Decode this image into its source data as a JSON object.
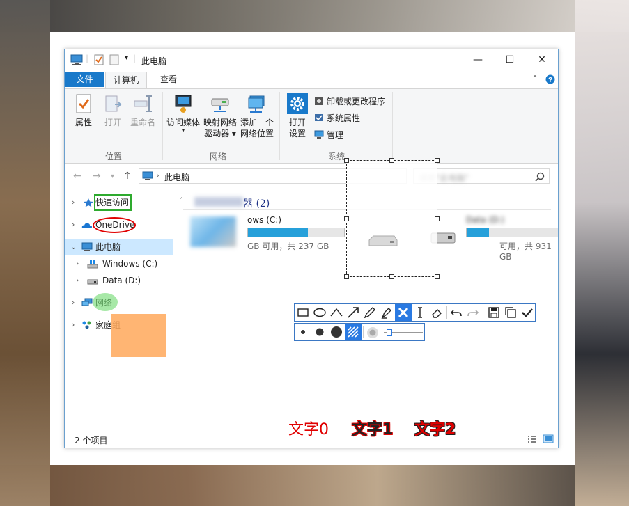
{
  "window": {
    "title": "此电脑",
    "min_glyph": "—",
    "max_glyph": "☐",
    "close_glyph": "✕"
  },
  "tabs": [
    {
      "label": "文件"
    },
    {
      "label": "计算机"
    },
    {
      "label": "查看"
    }
  ],
  "ribbon": {
    "groups": {
      "location": "位置",
      "network": "网络",
      "system": "系统"
    },
    "buttons": {
      "properties": "属性",
      "open": "打开",
      "rename": "重命名",
      "access_media": "访问媒体",
      "map_drive_line1": "映射网络",
      "map_drive_line2": "驱动器 ▾",
      "add_location_line1": "添加一个",
      "add_location_line2": "网络位置",
      "open_settings_line1": "打开",
      "open_settings_line2": "设置",
      "uninstall": "卸载或更改程序",
      "system_properties": "系统属性",
      "manage": "管理"
    }
  },
  "address": {
    "path": "此电脑",
    "search_placeholder": "搜索\"此电脑\""
  },
  "nav": {
    "items": [
      {
        "label": "快速访问"
      },
      {
        "label": "OneDrive"
      },
      {
        "label": "此电脑"
      },
      {
        "label": "Windows (C:)"
      },
      {
        "label": "Data (D:)"
      },
      {
        "label": "网络"
      },
      {
        "label": "家庭组"
      }
    ]
  },
  "content": {
    "section_title": "设备和驱动器 (2)",
    "section_visible": "器 (2)",
    "drives": [
      {
        "name_visible": "ows (C:)",
        "free_visible": "GB 可用，共 237 GB",
        "used_fraction": 0.62
      },
      {
        "name_visible": "Data (D:)",
        "free_visible": "可用，共 931 GB",
        "used_fraction": 0.17
      }
    ]
  },
  "status": {
    "count": "2 个项目"
  },
  "annotations": {
    "texts": [
      "文字0",
      "文字1",
      "文字2"
    ],
    "colors": {
      "red": "#e00000",
      "green_box": "#2eaa2e",
      "green_fill": "#8fe08f",
      "orange_fill": "#ffb26b",
      "accent": "#2a7ae2"
    }
  }
}
